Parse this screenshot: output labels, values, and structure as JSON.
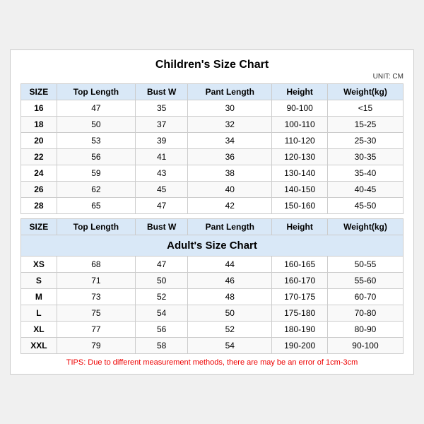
{
  "title": "Children's Size Chart",
  "unit": "UNIT: CM",
  "adult_title": "Adult's Size Chart",
  "tips": "TIPS: Due to different measurement methods, there are may be an error of 1cm-3cm",
  "columns": [
    "SIZE",
    "Top Length",
    "Bust W",
    "Pant Length",
    "Height",
    "Weight(kg)"
  ],
  "children_rows": [
    [
      "16",
      "47",
      "35",
      "30",
      "90-100",
      "<15"
    ],
    [
      "18",
      "50",
      "37",
      "32",
      "100-110",
      "15-25"
    ],
    [
      "20",
      "53",
      "39",
      "34",
      "110-120",
      "25-30"
    ],
    [
      "22",
      "56",
      "41",
      "36",
      "120-130",
      "30-35"
    ],
    [
      "24",
      "59",
      "43",
      "38",
      "130-140",
      "35-40"
    ],
    [
      "26",
      "62",
      "45",
      "40",
      "140-150",
      "40-45"
    ],
    [
      "28",
      "65",
      "47",
      "42",
      "150-160",
      "45-50"
    ]
  ],
  "adult_rows": [
    [
      "XS",
      "68",
      "47",
      "44",
      "160-165",
      "50-55"
    ],
    [
      "S",
      "71",
      "50",
      "46",
      "160-170",
      "55-60"
    ],
    [
      "M",
      "73",
      "52",
      "48",
      "170-175",
      "60-70"
    ],
    [
      "L",
      "75",
      "54",
      "50",
      "175-180",
      "70-80"
    ],
    [
      "XL",
      "77",
      "56",
      "52",
      "180-190",
      "80-90"
    ],
    [
      "XXL",
      "79",
      "58",
      "54",
      "190-200",
      "90-100"
    ]
  ]
}
